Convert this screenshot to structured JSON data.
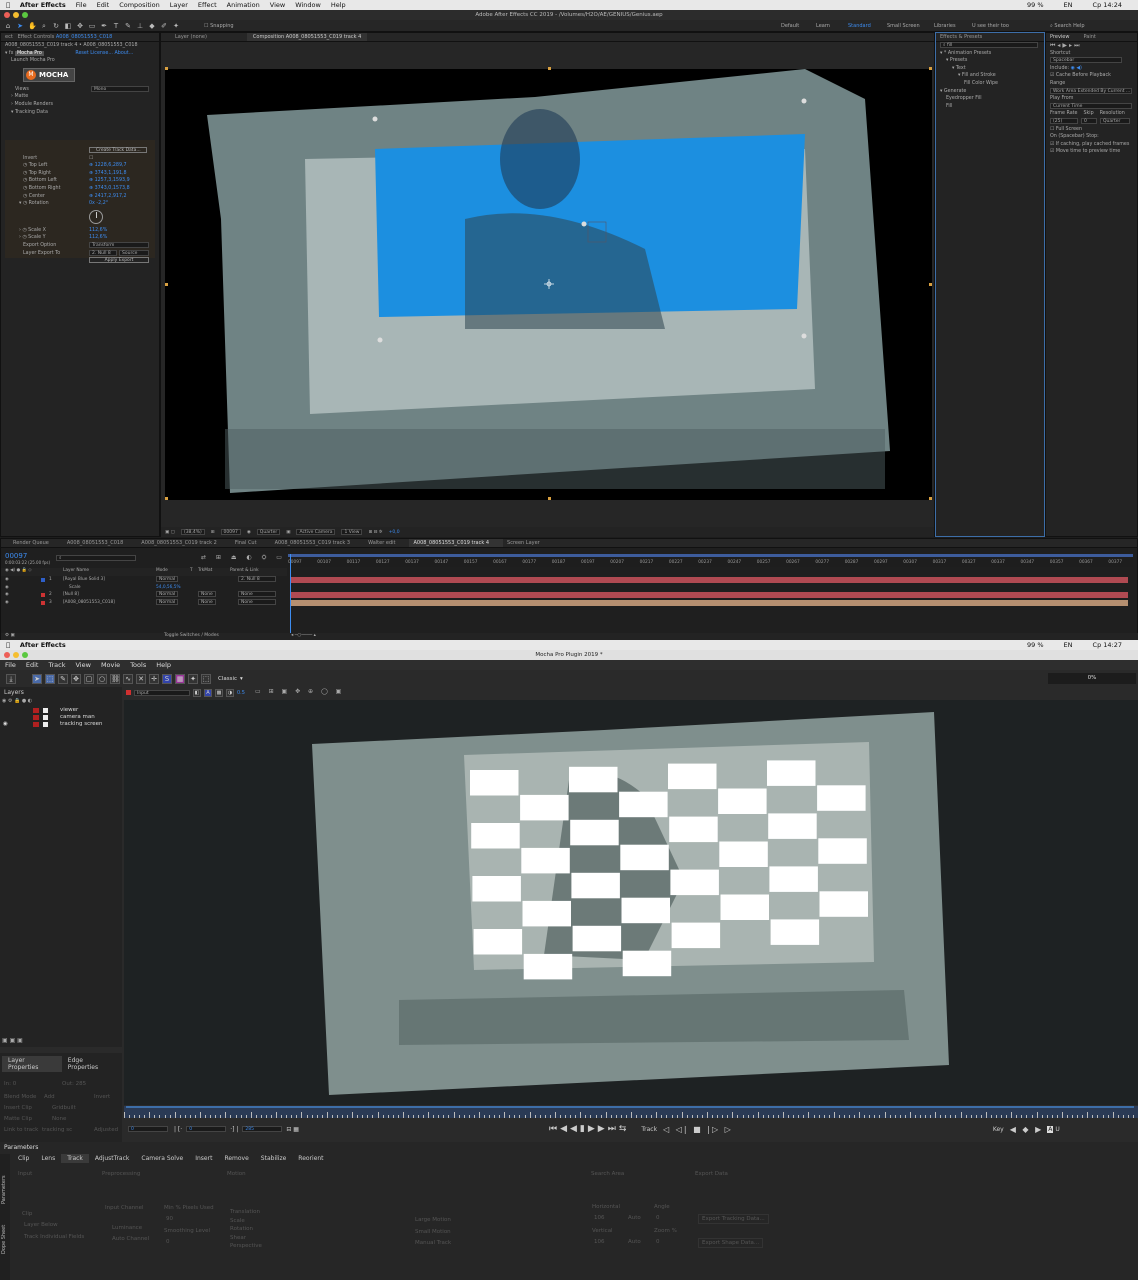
{
  "top": {
    "menubar": {
      "apple": "",
      "app": "After Effects",
      "items": [
        "File",
        "Edit",
        "Composition",
        "Layer",
        "Effect",
        "Animation",
        "View",
        "Window",
        "Help"
      ],
      "battery": "99 %",
      "kbd": "EN",
      "clock": "Ср 14:24"
    },
    "title": "Adobe After Effects CC 2019 - /Volumes/H2O/AE/GENIUS/Genius.aep",
    "toolbar": {
      "snapping": "Snapping",
      "workspaces": [
        "Default",
        "Learn",
        "Standard",
        "Small Screen",
        "Libraries",
        "U see their too"
      ],
      "search": "Search Help"
    },
    "effect_controls": {
      "tab_prefix": "ect",
      "tab": "Effect Controls",
      "tab_layer": "A008_08051553_C018",
      "subtitle": "A008_08051553_C019 track 4 • A008_08051553_C018",
      "plugin": "Mocha Pro",
      "links": [
        "Reset",
        "License...",
        "About..."
      ],
      "launch": "Launch Mocha Pro",
      "logo": "MOCHA",
      "rows": [
        {
          "label": "Views",
          "value": "Mono"
        },
        {
          "label": "Matte"
        },
        {
          "label": "Module Renders"
        },
        {
          "label": "Tracking Data"
        }
      ],
      "create_btn": "Create Track Data...",
      "params": [
        {
          "label": "Invert",
          "value": ""
        },
        {
          "label": "Top Left",
          "value": "1228,6,289,7"
        },
        {
          "label": "Top Right",
          "value": "3743,1,191,8"
        },
        {
          "label": "Bottom Left",
          "value": "1257,3,1593,9"
        },
        {
          "label": "Bottom Right",
          "value": "3743,0,1573,8"
        },
        {
          "label": "Center",
          "value": "2417,2,917,2"
        },
        {
          "label": "Rotation",
          "value": "0x -2,2°"
        }
      ],
      "scale": [
        {
          "label": "Scale X",
          "value": "112,6%"
        },
        {
          "label": "Scale Y",
          "value": "112,6%"
        }
      ],
      "export_option": {
        "label": "Export Option",
        "value": "Transform"
      },
      "layer_export": {
        "label": "Layer Export To",
        "value": "2. Null 8",
        "src": "Source"
      },
      "apply_btn": "Apply Export"
    },
    "comp": {
      "tab1": "Layer (none)",
      "tab2": "Composition A008_08051553_C019 track 4",
      "footer": {
        "zoom": "(38,4%)",
        "time": "00097",
        "quality": "Quarter",
        "camera": "Active Camera",
        "view": "1 View",
        "exposure": "+0,0"
      }
    },
    "effects": {
      "title": "Effects & Presets",
      "search": "fill",
      "tree": [
        {
          "t": "▾ * Animation Presets",
          "d": 0
        },
        {
          "t": "▾ Presets",
          "d": 1
        },
        {
          "t": "▾ Text",
          "d": 2
        },
        {
          "t": "▾ Fill and Stroke",
          "d": 3
        },
        {
          "t": "Fill Color Wipe",
          "d": 4
        },
        {
          "t": "▾ Generate",
          "d": 0
        },
        {
          "t": "Eyedropper Fill",
          "d": 1
        },
        {
          "t": "Fill",
          "d": 1
        }
      ]
    },
    "preview": {
      "tab1": "Preview",
      "tab2": "Paint",
      "shortcut_label": "Shortcut",
      "shortcut": "Spacebar",
      "include": "Include:",
      "cache": "Cache Before Playback",
      "range_label": "Range",
      "range": "Work Area Extended By Current ...",
      "play_from_label": "Play From",
      "play_from": "Current Time",
      "fr_label": "Frame Rate",
      "skip_label": "Skip",
      "res_label": "Resolution",
      "fr": "(25)",
      "skip": "0",
      "res": "Quarter",
      "full": "Full Screen",
      "spacebar_stop": "On (Spacebar) Stop:",
      "opt1": "If caching, play cached frames",
      "opt2": "Move time to preview time"
    },
    "timeline": {
      "tabs": [
        "Render Queue",
        "A008_08051553_C018",
        "A008_08051553_C019 track 2",
        "Final Cut",
        "A008_08051553_C019 track 3",
        "Walter edit",
        "A008_08051553_C019 track 4",
        "Screen Layer"
      ],
      "time": "00097",
      "sub": "0:00:03:22 (25.00 fps)",
      "headers": [
        "Layer Name",
        "Mode",
        "T",
        "TrkMat",
        "Parent & Link"
      ],
      "ticks": [
        "00097",
        "00107",
        "00117",
        "00127",
        "00137",
        "00147",
        "00157",
        "00167",
        "00177",
        "00187",
        "00197",
        "00207",
        "00217",
        "00227",
        "00237",
        "00247",
        "00257",
        "00267",
        "00277",
        "00287",
        "00297",
        "00307",
        "00317",
        "00327",
        "00337",
        "00347",
        "00357",
        "00367",
        "00377"
      ],
      "layers": [
        {
          "num": "1",
          "name": "[Royal Blue Solid 3]",
          "mode": "Normal",
          "trk": "",
          "parent": "2. Null 8",
          "color": "#2e5fc9"
        },
        {
          "num": "",
          "name": "Scale",
          "mode": "54,0,56,5%",
          "trk": "",
          "parent": "",
          "color": ""
        },
        {
          "num": "2",
          "name": "[Null 8]",
          "mode": "Normal",
          "trk": "None",
          "parent": "None",
          "color": "#cc3333"
        },
        {
          "num": "3",
          "name": "[A008_08051553_C018]",
          "mode": "Normal",
          "trk": "None",
          "parent": "None",
          "color": "#cc3333"
        }
      ],
      "toggle": "Toggle Switches / Modes"
    }
  },
  "bottom": {
    "menubar": {
      "app": "After Effects",
      "battery": "99 %",
      "kbd": "EN",
      "clock": "Ср 14:27"
    },
    "title": "Mocha Pro Plugin 2019 *",
    "menu": [
      "File",
      "Edit",
      "Track",
      "View",
      "Movie",
      "Tools",
      "Help"
    ],
    "view_mode": "Classic",
    "progress": "0%",
    "layers": {
      "title": "Layers",
      "clip": "Input",
      "items": [
        "viewer",
        "camera man",
        "tracking screen"
      ]
    },
    "layer_props": {
      "tab1": "Layer Properties",
      "tab2": "Edge Properties",
      "in": "In: 0",
      "out": "Out: 285",
      "blend": "Blend Mode",
      "blend_v": "Add",
      "invert": "Invert",
      "insert": "Insert Clip",
      "insert_v": "Gridbuilt",
      "matte": "Matte Clip",
      "matte_v": "None",
      "link": "Link to track",
      "link_v": "tracking sc",
      "adjusted": "Adjusted"
    },
    "transport": {
      "in": "0",
      "cur": "0",
      "out": "285",
      "track": "Track",
      "key": "Key"
    },
    "params": {
      "title": "Parameters",
      "tabs": [
        "Clip",
        "Lens",
        "Track",
        "AdjustTrack",
        "Camera Solve",
        "Insert",
        "Remove",
        "Stabilize",
        "Reorient"
      ],
      "active": "Track",
      "side": [
        "Parameters",
        "Dope Sheet"
      ],
      "sections": [
        "Input",
        "Preprocessing",
        "Motion",
        "Search Area",
        "Export Data"
      ],
      "clip": "Clip",
      "clip_v": "Layer Below",
      "track_ind": "Track Individual Fields",
      "input_channel": "Input Channel",
      "lum": "Luminance",
      "auto_ch": "Auto Channel",
      "min_pix": "Min % Pixels Used",
      "min_v": "90",
      "smooth": "Smoothing Level",
      "smooth_v": "0",
      "motion": [
        "Translation",
        "Scale",
        "Rotation",
        "Shear",
        "Perspective"
      ],
      "motion2": [
        "Large Motion",
        "Small Motion",
        "Manual Track"
      ],
      "horiz": "Horizontal",
      "horiz_v": "106",
      "vert": "Vertical",
      "vert_v": "106",
      "auto": "Auto",
      "angle": "Angle",
      "angle_v": "0",
      "zoom": "Zoom %",
      "zoom_v": "0",
      "export1": "Export Tracking Data...",
      "export2": "Export Shape Data..."
    }
  }
}
